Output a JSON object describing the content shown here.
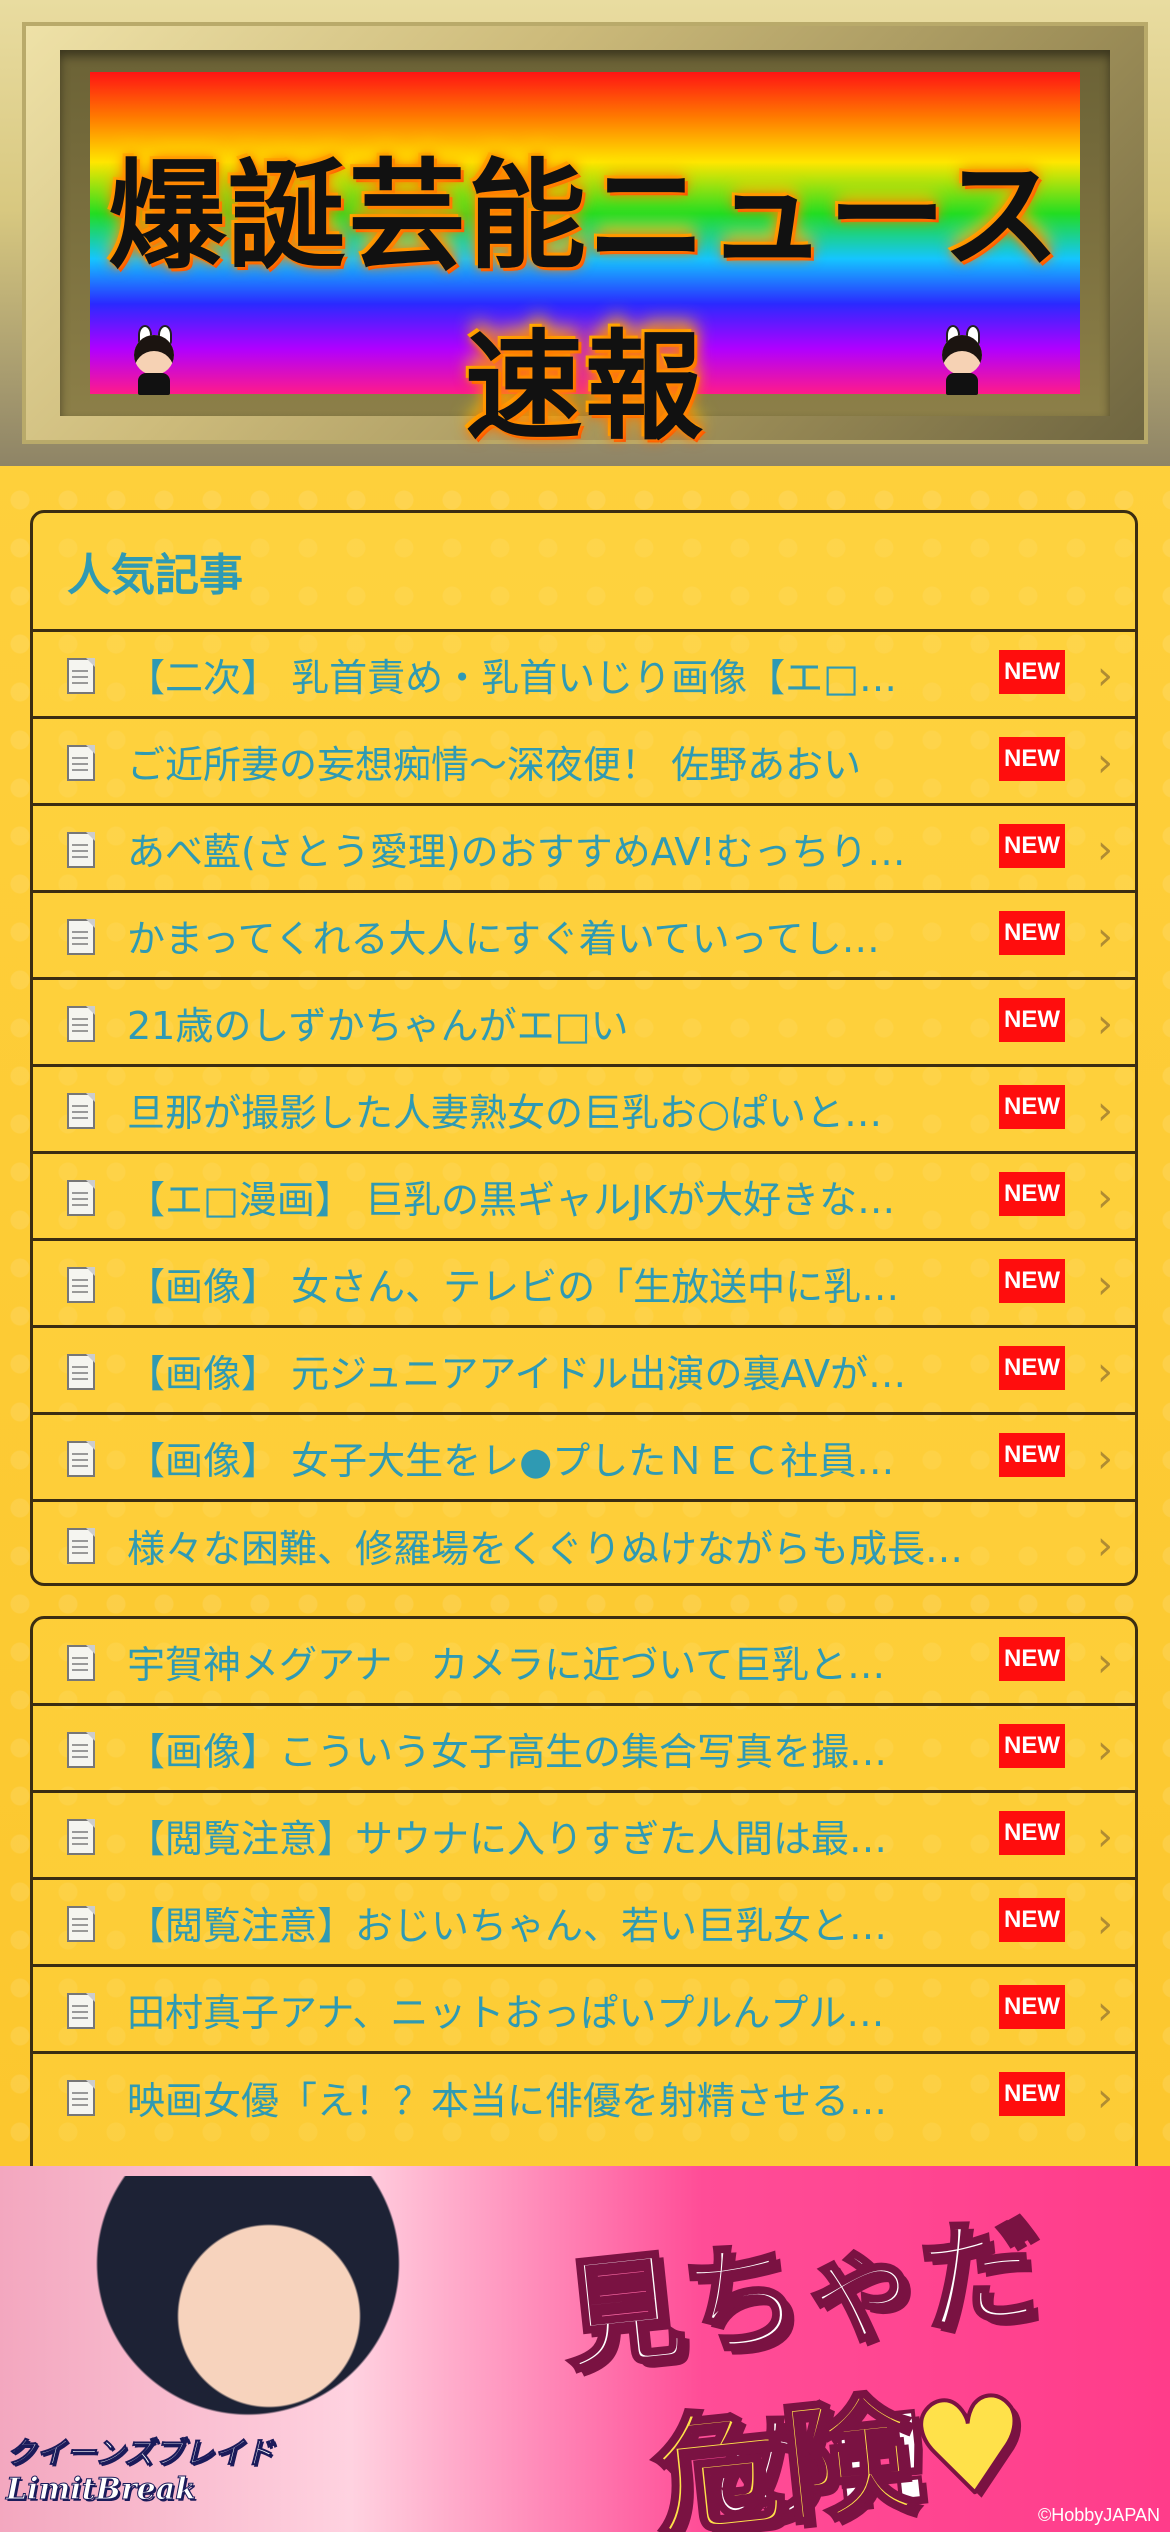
{
  "header": {
    "title": "爆誕芸能ニュース速報"
  },
  "popular": {
    "heading": "人気記事",
    "items": [
      {
        "text": "【二次】 乳首責め・乳首いじり画像【エ□…",
        "badge": "NEW"
      },
      {
        "text": "ご近所妻の妄想痴情〜深夜便！ 佐野あおい",
        "badge": "NEW"
      },
      {
        "text": "あべ藍(さとう愛理)のおすすめAV!むっちり…",
        "badge": "NEW"
      },
      {
        "text": "かまってくれる大人にすぐ着いていってし…",
        "badge": "NEW"
      },
      {
        "text": "21歳のしずかちゃんがエ□い",
        "badge": "NEW"
      },
      {
        "text": "旦那が撮影した人妻熟女の巨乳お○ぱいと…",
        "badge": "NEW"
      },
      {
        "text": "【エ□漫画】 巨乳の黒ギャルJKが大好きな…",
        "badge": "NEW"
      },
      {
        "text": "【画像】 女さん、テレビの「生放送中に乳…",
        "badge": "NEW"
      },
      {
        "text": "【画像】 元ジュニアアイドル出演の裏AVが…",
        "badge": "NEW"
      },
      {
        "text": "【画像】 女子大生をレ●プしたＮＥＣ社員…",
        "badge": "NEW"
      },
      {
        "text": "様々な困難、修羅場をくぐりぬけながらも成長…",
        "badge": ""
      }
    ]
  },
  "latest": {
    "items": [
      {
        "text": "宇賀神メグアナ　カメラに近づいて巨乳と…",
        "badge": "NEW"
      },
      {
        "text": "【画像】こういう女子高生の集合写真を撮…",
        "badge": "NEW"
      },
      {
        "text": "【閲覧注意】サウナに入りすぎた人間は最…",
        "badge": "NEW"
      },
      {
        "text": "【閲覧注意】おじいちゃん、若い巨乳女と…",
        "badge": "NEW"
      },
      {
        "text": "田村真子アナ、ニットおっぱいプルんプル…",
        "badge": "NEW"
      },
      {
        "text": "映画女優「え！？本当に俳優を射精させる…",
        "badge": "NEW"
      }
    ]
  },
  "ad": {
    "catch": "見ちゃだめ!!",
    "danger": "危険♥",
    "logo_line1": "クイーンズブレイド",
    "logo_line2": "LimitBreak",
    "copyright": "©HobbyJAPAN"
  },
  "colors": {
    "link": "#2f9ab3",
    "badge": "#ff0d0d",
    "border": "#3b2d12"
  }
}
